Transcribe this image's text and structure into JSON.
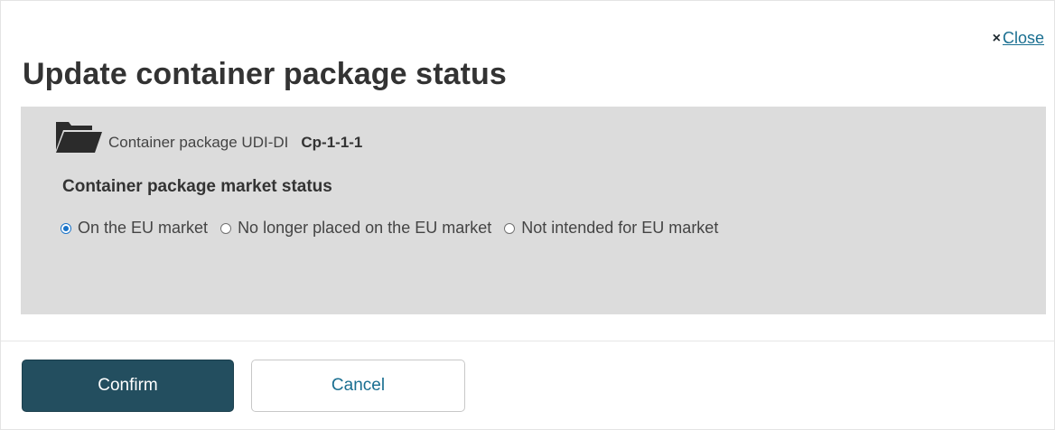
{
  "dialog": {
    "close_label": "Close",
    "close_icon": "×",
    "title": "Update container package status"
  },
  "panel": {
    "udi_label": "Container package UDI-DI",
    "udi_value": "Cp-1-1-1",
    "folder_icon": "folder-open-icon",
    "section_heading": "Container package market status",
    "options": [
      {
        "label": "On the EU market",
        "checked": true
      },
      {
        "label": "No longer placed on the EU market",
        "checked": false
      },
      {
        "label": "Not intended for EU market",
        "checked": false
      }
    ]
  },
  "footer": {
    "confirm_label": "Confirm",
    "cancel_label": "Cancel"
  },
  "colors": {
    "primary": "#234e5f",
    "link": "#1a6f91",
    "panel_bg": "#dcdcdc",
    "radio_checked": "#1a73c8"
  }
}
